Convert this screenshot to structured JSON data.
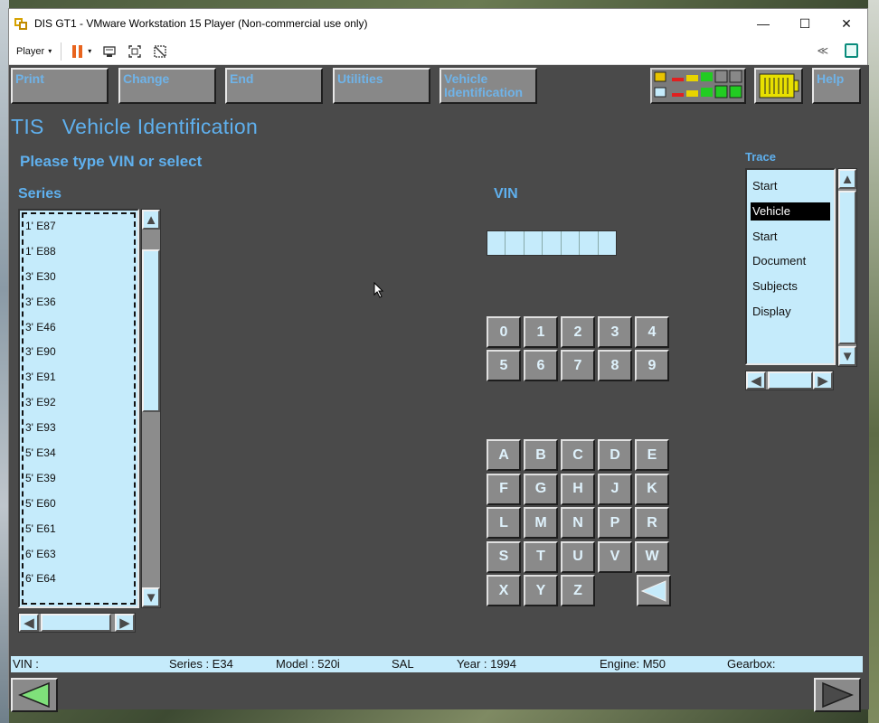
{
  "window": {
    "title": "DIS GT1 - VMware Workstation 15 Player (Non-commercial use only)",
    "minimize": "—",
    "maximize": "☐",
    "close": "✕"
  },
  "vmware_toolbar": {
    "player_label": "Player",
    "player_caret": "▾",
    "pause_caret": "▾",
    "unity_label": "≪"
  },
  "tis_toolbar": {
    "print": "Print",
    "change": "Change",
    "end": "End",
    "utilities": "Utilities",
    "vehicle_identification": "Vehicle Identification",
    "help": "Help"
  },
  "page": {
    "title": "TIS   Vehicle Identification",
    "prompt": "Please type VIN or select",
    "series_heading": "Series",
    "vin_heading": "VIN",
    "trace_heading": "Trace"
  },
  "series": {
    "items": [
      "1' E87",
      "1' E88",
      "3' E30",
      "3' E36",
      "3' E46",
      "3' E90",
      "3' E91",
      "3' E92",
      "3' E93",
      "5' E34",
      "5' E39",
      "5' E60",
      "5' E61",
      "6' E63",
      "6' E64"
    ]
  },
  "scroll": {
    "up": "▲",
    "down": "▼",
    "left": "◀",
    "right": "▶"
  },
  "keypad": {
    "digits": [
      "0",
      "1",
      "2",
      "3",
      "4",
      "5",
      "6",
      "7",
      "8",
      "9"
    ],
    "letters": [
      "A",
      "B",
      "C",
      "D",
      "E",
      "F",
      "G",
      "H",
      "J",
      "K",
      "L",
      "M",
      "N",
      "P",
      "R",
      "S",
      "T",
      "U",
      "V",
      "W",
      "X",
      "Y",
      "Z"
    ],
    "backspace": "◀"
  },
  "trace": {
    "items": [
      "Start",
      "Vehicle",
      "Start",
      "Document",
      "Subjects",
      "Display"
    ],
    "selected_index": 1
  },
  "statusbar": {
    "vin": "VIN :",
    "series": "Series : E34",
    "model": "Model : 520i",
    "sal": "SAL",
    "year": "Year : 1994",
    "engine": "Engine: M50",
    "gearbox": "Gearbox:"
  },
  "colors": {
    "accent_text": "#5fb0ee",
    "list_background": "#c5ebfb",
    "guest_background": "#4a4a4a",
    "pause_orange": "#e8641e",
    "nav_arrow_green": "#7fe07a"
  }
}
